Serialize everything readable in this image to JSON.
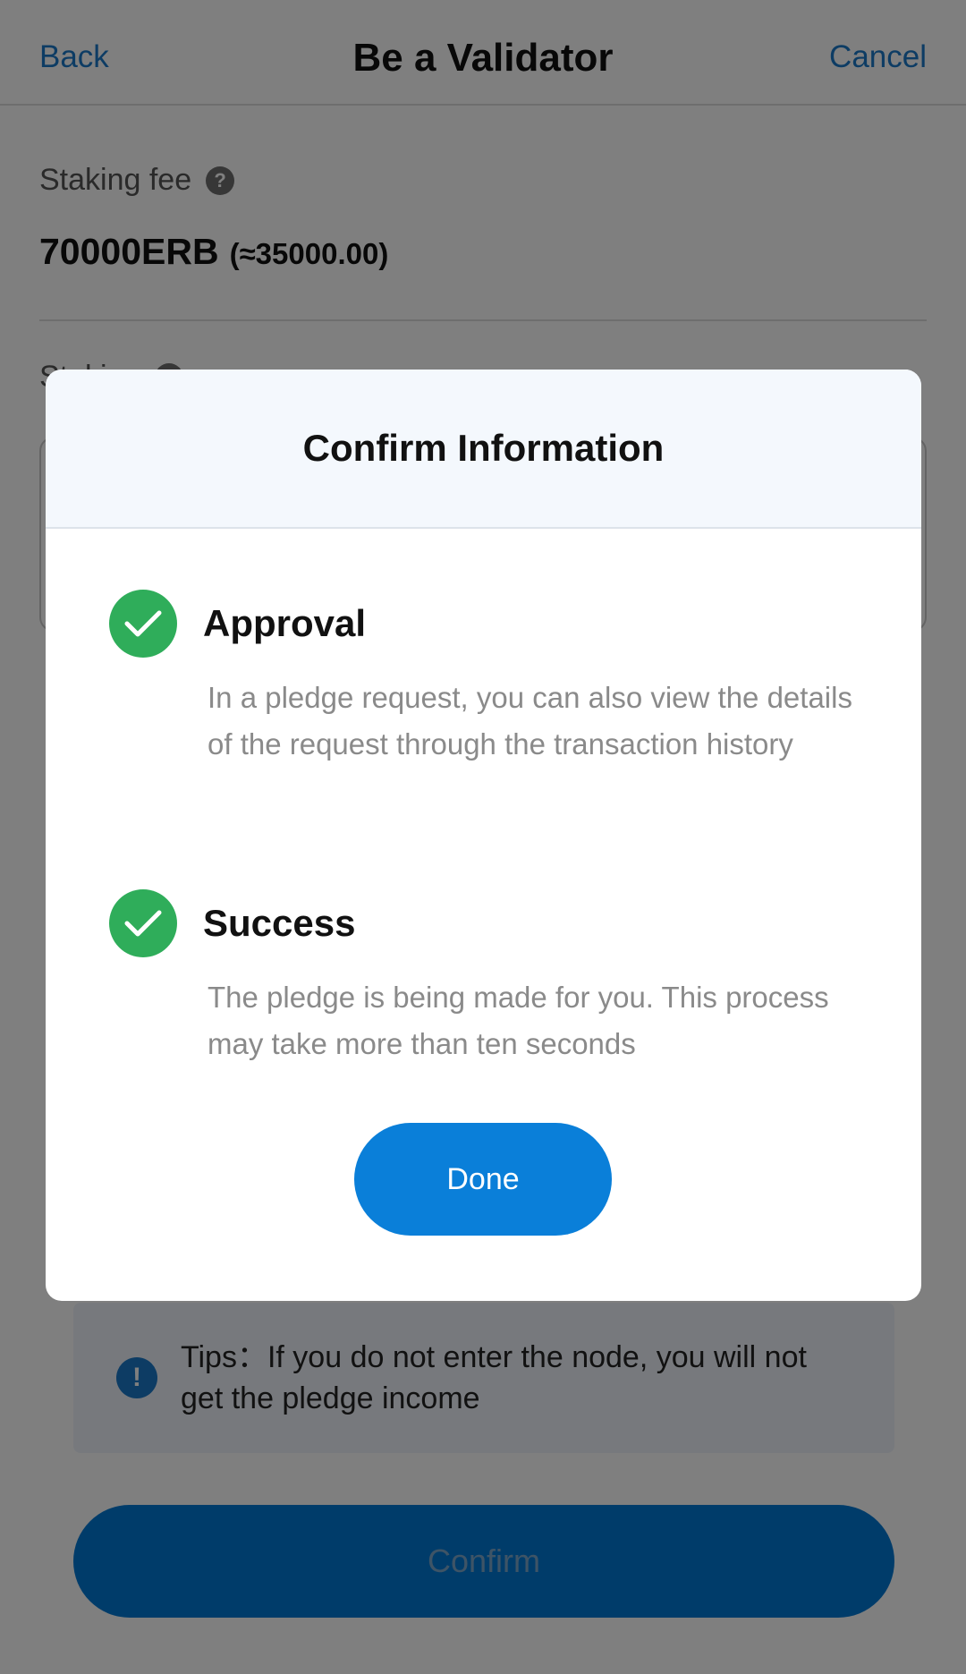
{
  "nav": {
    "back_label": "Back",
    "title": "Be a Validator",
    "cancel_label": "Cancel"
  },
  "staking_fee": {
    "label": "Staking fee",
    "help_icon": "question-circle-icon",
    "amount": "70000ERB",
    "fiat": "(≈35000.00)"
  },
  "staking": {
    "label": "Staking"
  },
  "tips": {
    "icon": "exclamation-circle-icon",
    "text": "Tips：If you do not enter the node, you will not get the pledge income"
  },
  "confirm_label": "Confirm",
  "modal": {
    "title": "Confirm Information",
    "steps": [
      {
        "icon": "check-circle-icon",
        "title": "Approval",
        "description": "In a pledge request, you can also view the details of the request through the transaction history"
      },
      {
        "icon": "check-circle-icon",
        "title": "Success",
        "description": "The pledge is being made for you. This process may take more than ten seconds"
      }
    ],
    "done_label": "Done"
  },
  "colors": {
    "accent": "#0a7fd9",
    "success": "#2fad5a",
    "overlay": "rgba(0,0,0,0.5)"
  }
}
